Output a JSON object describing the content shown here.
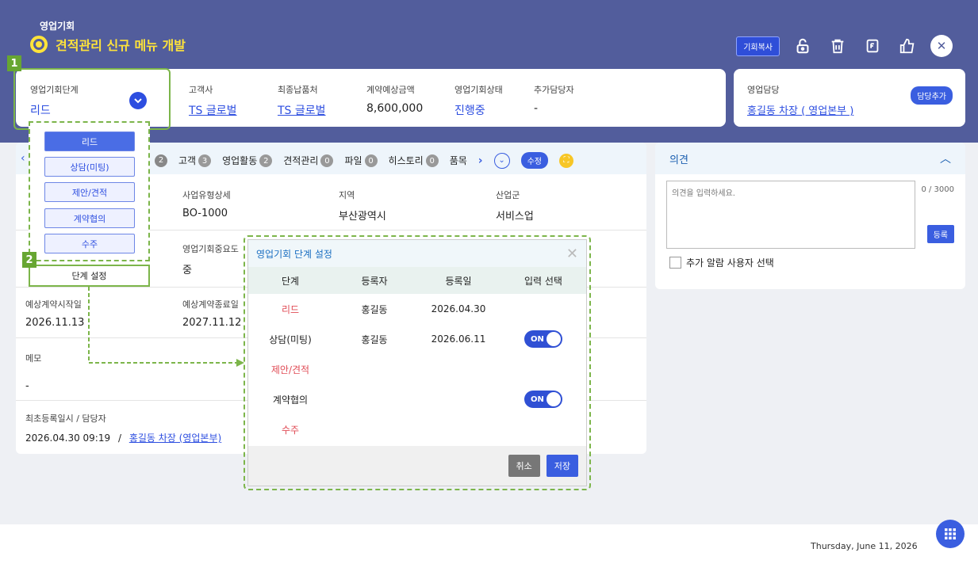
{
  "header": {
    "subtitle": "영업기회",
    "title": "견적관리 신규 메뉴 개발",
    "copy_label": "기회복사",
    "icons": [
      "lock-icon",
      "delete-icon",
      "file-icon",
      "like-icon",
      "close-icon"
    ]
  },
  "summary": {
    "stage_label": "영업기회단계",
    "stage_value": "리드",
    "customer_label": "고객사",
    "customer_value": "TS 글로벌",
    "delivery_label": "최종납품처",
    "delivery_value": "TS 글로벌",
    "amount_label": "계약예상금액",
    "amount_value": "8,600,000",
    "status_label": "영업기회상태",
    "status_value": "진행중",
    "extra_label": "추가담당자",
    "extra_value": "-",
    "owner_label": "영업담당",
    "owner_value": "홍길동 차장 ( 영업본부 )",
    "add_owner_btn": "담당추가"
  },
  "markers": {
    "m1": "1",
    "m2": "2"
  },
  "stage_menu": {
    "items": [
      "리드",
      "상담(미팅)",
      "제안/견적",
      "계약협의",
      "수주"
    ],
    "settings_label": "단계 설정"
  },
  "tabs": {
    "items": [
      {
        "label": "",
        "count": "2"
      },
      {
        "label": "고객",
        "count": "3"
      },
      {
        "label": "영업활동",
        "count": "2"
      },
      {
        "label": "견적관리",
        "count": "0"
      },
      {
        "label": "파일",
        "count": "0"
      },
      {
        "label": "히스토리",
        "count": "0"
      },
      {
        "label": "품목",
        "count": ""
      }
    ],
    "edit_label": "수정"
  },
  "detail": {
    "biz_type_label": "사업유형상세",
    "biz_type_value": "BO-1000",
    "region_label": "지역",
    "region_value": "부산광역시",
    "industry_label": "산업군",
    "industry_value": "서비스업",
    "importance_label": "영업기회중요도",
    "importance_value": "중",
    "start_label": "예상계약시작일",
    "start_value": "2026.11.13",
    "end_label": "예상계약종료일",
    "end_value": "2027.11.12",
    "memo_label": "메모",
    "memo_value": "-",
    "reg_label": "최초등록일시 / 담당자",
    "reg_value": "2026.04.30 09:19",
    "reg_sep": "/",
    "reg_owner": "홍길동 차장 (영업본부)"
  },
  "modal": {
    "title": "영업기회 단계 설정",
    "headers": [
      "단계",
      "등록자",
      "등록일",
      "입력 선택"
    ],
    "rows": [
      {
        "stage": "리드",
        "user": "홍길동",
        "date": "2026.04.30",
        "toggle": ""
      },
      {
        "stage": "상담(미팅)",
        "user": "홍길동",
        "date": "2026.06.11",
        "toggle": "ON"
      },
      {
        "stage": "제안/견적",
        "user": "",
        "date": "",
        "toggle": ""
      },
      {
        "stage": "계약협의",
        "user": "",
        "date": "",
        "toggle": "ON"
      },
      {
        "stage": "수주",
        "user": "",
        "date": "",
        "toggle": ""
      }
    ],
    "cancel": "취소",
    "save": "저장"
  },
  "opinion": {
    "title": "의견",
    "placeholder": "의견을 입력하세요.",
    "counter": "0 / 3000",
    "register": "등록",
    "alarm_label": "추가 알람 사용자 선택"
  },
  "footer": {
    "date": "Thursday, June 11, 2026"
  },
  "colors": {
    "header": "#525d9c",
    "accent": "#2d4ee0",
    "marker": "#67a632",
    "danger": "#e04b55"
  }
}
